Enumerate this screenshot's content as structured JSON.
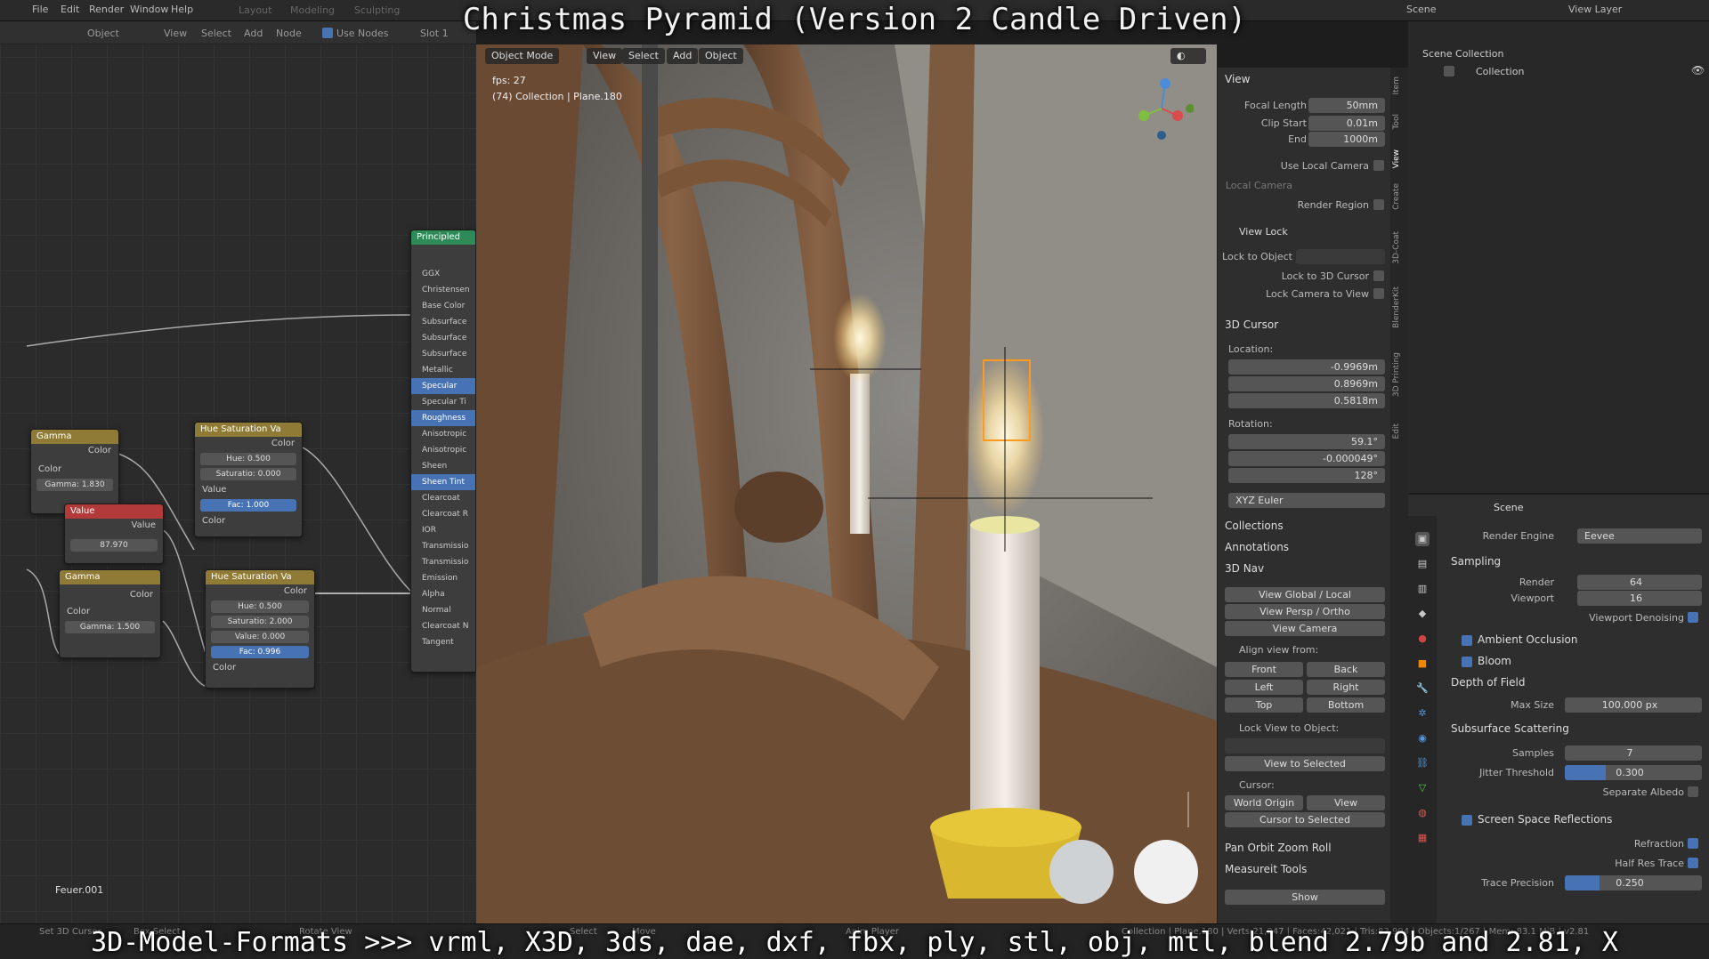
{
  "overlay": {
    "title": "Christmas Pyramid (Version 2 Candle Driven)",
    "bottom_caption": "3D-Model-Formats >>> vrml, X3D, 3ds, dae, dxf, fbx, ply, stl, obj, mtl, blend 2.79b and 2.81, X"
  },
  "topbar": {
    "menus": [
      "File",
      "Edit",
      "Render",
      "Window",
      "Help"
    ],
    "workspaces": [
      "Layout",
      "Modeling",
      "Sculpting"
    ],
    "scene": "Scene",
    "view_layer": "View Layer"
  },
  "node_editor": {
    "header": {
      "object": "Object",
      "view": "View",
      "select": "Select",
      "add": "Add",
      "node": "Node",
      "use_nodes": "Use Nodes",
      "slot": "Slot 1"
    },
    "material_label": "Feuer.001",
    "nodes": {
      "gamma1": {
        "title": "Gamma",
        "out": "Color",
        "in_color": "Color",
        "gamma": "Gamma: 1.830"
      },
      "value": {
        "title": "Value",
        "out": "Value",
        "val": "87.970"
      },
      "gamma2": {
        "title": "Gamma",
        "out": "Color",
        "in_color": "Color",
        "gamma": "Gamma: 1.500"
      },
      "hsv1": {
        "title": "Hue Saturation Va",
        "out": "Color",
        "hue": "Hue: 0.500",
        "sat": "Saturatio: 0.000",
        "val": "Value",
        "fac": "Fac: 1.000",
        "color": "Color"
      },
      "hsv2": {
        "title": "Hue Saturation Va",
        "out": "Color",
        "hue": "Hue: 0.500",
        "sat": "Saturatio: 2.000",
        "val": "Value: 0.000",
        "fac": "Fac: 0.996",
        "color": "Color"
      },
      "principled": {
        "title": "Principled",
        "inputs": [
          "GGX",
          "Christensen",
          "Base Color",
          "Subsurface",
          "Subsurface",
          "Subsurface",
          "Metallic",
          "Specular",
          "Specular Ti",
          "Roughness",
          "Anisotropic",
          "Anisotropic",
          "Sheen",
          "Sheen Tint",
          "Clearcoat",
          "Clearcoat R",
          "IOR",
          "Transmissio",
          "Transmissio",
          "Emission",
          "Alpha",
          "Normal",
          "Clearcoat N",
          "Tangent"
        ]
      }
    }
  },
  "viewport": {
    "mode": "Object Mode",
    "menus": [
      "View",
      "Select",
      "Add",
      "Object"
    ],
    "fps": "fps: 27",
    "info": "(74) Collection | Plane.180"
  },
  "npanel": {
    "tabs": [
      "Item",
      "Tool",
      "View",
      "Create",
      "3D-Coat",
      "BlenderKit",
      "3D Printing",
      "Edit"
    ],
    "view": {
      "title": "View",
      "focal_length_label": "Focal Length",
      "focal_length": "50mm",
      "clip_start_label": "Clip Start",
      "clip_start": "0.01m",
      "end_label": "End",
      "end": "1000m",
      "use_local_camera": "Use Local Camera",
      "local_camera": "Local Camera",
      "render_region": "Render Region",
      "view_lock": "View Lock",
      "lock_to_object": "Lock to Object",
      "lock_to_3d_cursor": "Lock to 3D Cursor",
      "lock_camera_to_view": "Lock Camera to View"
    },
    "cursor": {
      "title": "3D Cursor",
      "location": "Location:",
      "x": "-0.9969m",
      "y": "0.8969m",
      "z": "0.5818m",
      "rotation": "Rotation:",
      "rx": "59.1°",
      "ry": "-0.000049°",
      "rz": "128°",
      "euler": "XYZ Euler"
    },
    "collections": "Collections",
    "annotations": "Annotations",
    "nav": {
      "title": "3D Nav",
      "view_global_local": "View Global / Local",
      "view_persp_ortho": "View Persp / Ortho",
      "view_camera": "View Camera",
      "align_view_from": "Align view from:",
      "front": "Front",
      "back": "Back",
      "left": "Left",
      "right": "Right",
      "top": "Top",
      "bottom": "Bottom",
      "lock_view_to_object": "Lock View to Object:",
      "view_to_selected": "View to Selected",
      "cursor": "Cursor:",
      "world_origin": "World Origin",
      "view": "View",
      "cursor_to_selected": "Cursor to Selected"
    },
    "pan_orbit": "Pan Orbit Zoom Roll",
    "measureit": "Measureit Tools",
    "show": "Show"
  },
  "outliner": {
    "scene_collection": "Scene Collection",
    "collection": "Collection"
  },
  "properties": {
    "header": "Scene",
    "render_engine_label": "Render Engine",
    "render_engine": "Eevee",
    "sampling": "Sampling",
    "render_label": "Render",
    "render": "64",
    "viewport_label": "Viewport",
    "viewport": "16",
    "viewport_denoising": "Viewport Denoising",
    "ambient_occlusion": "Ambient Occlusion",
    "bloom": "Bloom",
    "dof": "Depth of Field",
    "max_size_label": "Max Size",
    "max_size": "100.000 px",
    "sss": "Subsurface Scattering",
    "samples_label": "Samples",
    "samples": "7",
    "jitter_label": "Jitter Threshold",
    "jitter": "0.300",
    "separate_albedo": "Separate Albedo",
    "ssr": "Screen Space Reflections",
    "refraction": "Refraction",
    "half_res": "Half Res Trace",
    "trace_precision_label": "Trace Precision",
    "trace_precision": "0.250",
    "jitter_fill": 0.3,
    "trace_fill": 0.25
  },
  "statusbar": {
    "items": [
      "Set 3D Cursor",
      "Box Select",
      "Rotate View",
      "Select",
      "Move",
      "Anim Player"
    ],
    "stats": "Collection | Plane.180 | Verts:21,847 | Faces:42,021 | Tris:83,994 | Objects:1/267 | Mem: 83.1 MiB | v2.81"
  }
}
